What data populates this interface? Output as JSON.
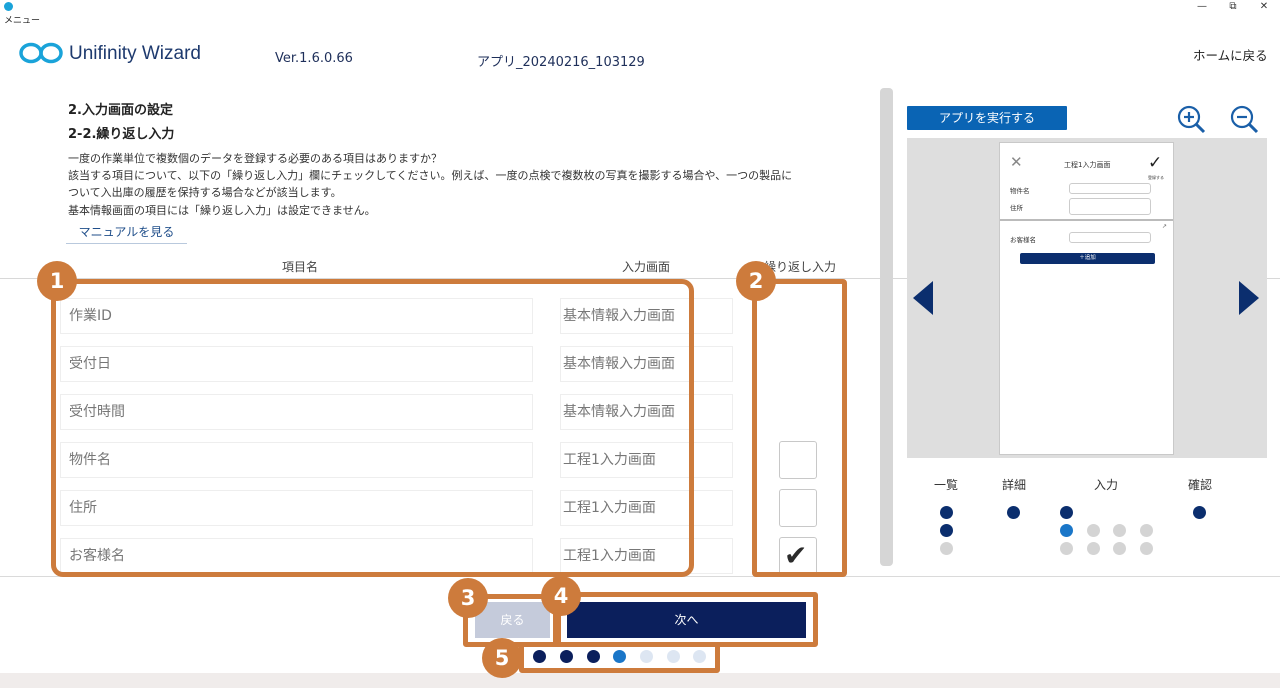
{
  "window": {
    "title": "メニュー",
    "minimize": "—",
    "maximize": "⧉",
    "close": "✕"
  },
  "header": {
    "brand": "Unifinity Wizard",
    "version": "Ver.1.6.0.66",
    "app_name": "アプリ_20240216_103129",
    "home_link": "ホームに戻る"
  },
  "instructions": {
    "section_title": "2.入力画面の設定",
    "sub_title": "2-2.繰り返し入力",
    "lines": [
      "一度の作業単位で複数個のデータを登録する必要のある項目はありますか？",
      "該当する項目について、以下の「繰り返し入力」欄にチェックしてください。例えば、一度の点検で複数枚の写真を撮影する場合や、一つの製品に",
      "ついて入出庫の履歴を保持する場合などが該当します。",
      "基本情報画面の項目には「繰り返し入力」は設定できません。"
    ],
    "manual_link": "マニュアルを見る"
  },
  "table": {
    "headers": {
      "name": "項目名",
      "screen": "入力画面",
      "repeat": "繰り返し入力"
    },
    "rows": [
      {
        "name": "作業ID",
        "screen": "基本情報入力画面",
        "checkbox": false,
        "checked": false
      },
      {
        "name": "受付日",
        "screen": "基本情報入力画面",
        "checkbox": false,
        "checked": false
      },
      {
        "name": "受付時間",
        "screen": "基本情報入力画面",
        "checkbox": false,
        "checked": false
      },
      {
        "name": "物件名",
        "screen": "工程1入力画面",
        "checkbox": true,
        "checked": false
      },
      {
        "name": "住所",
        "screen": "工程1入力画面",
        "checkbox": true,
        "checked": false
      },
      {
        "name": "お客様名",
        "screen": "工程1入力画面",
        "checkbox": true,
        "checked": true
      }
    ],
    "check_glyph": "✔"
  },
  "preview": {
    "run_button": "アプリを実行する",
    "icons": {
      "zoom_in": "zoom-in-icon",
      "zoom_out": "zoom-out-icon",
      "prev": "left-arrow-icon",
      "next": "right-arrow-icon"
    },
    "phone": {
      "title": "工程1入力画面",
      "close_glyph": "✕",
      "confirm_glyph": "✓",
      "confirm_label": "登録する",
      "fields": [
        "物件名",
        "住所"
      ],
      "repeat_field": "お客様名",
      "repeat_marker": "↗",
      "add_button": "＋追加"
    },
    "steps": [
      "一覧",
      "詳細",
      "入力",
      "確認"
    ]
  },
  "footer": {
    "back_button": "戻る",
    "next_button": "次へ",
    "progress": {
      "total": 7,
      "current": 4
    }
  },
  "callouts": [
    "1",
    "2",
    "3",
    "4",
    "5"
  ],
  "colors": {
    "accent": "#cd7b3c",
    "navy": "#0b1f5c",
    "blue": "#1a76c8"
  }
}
